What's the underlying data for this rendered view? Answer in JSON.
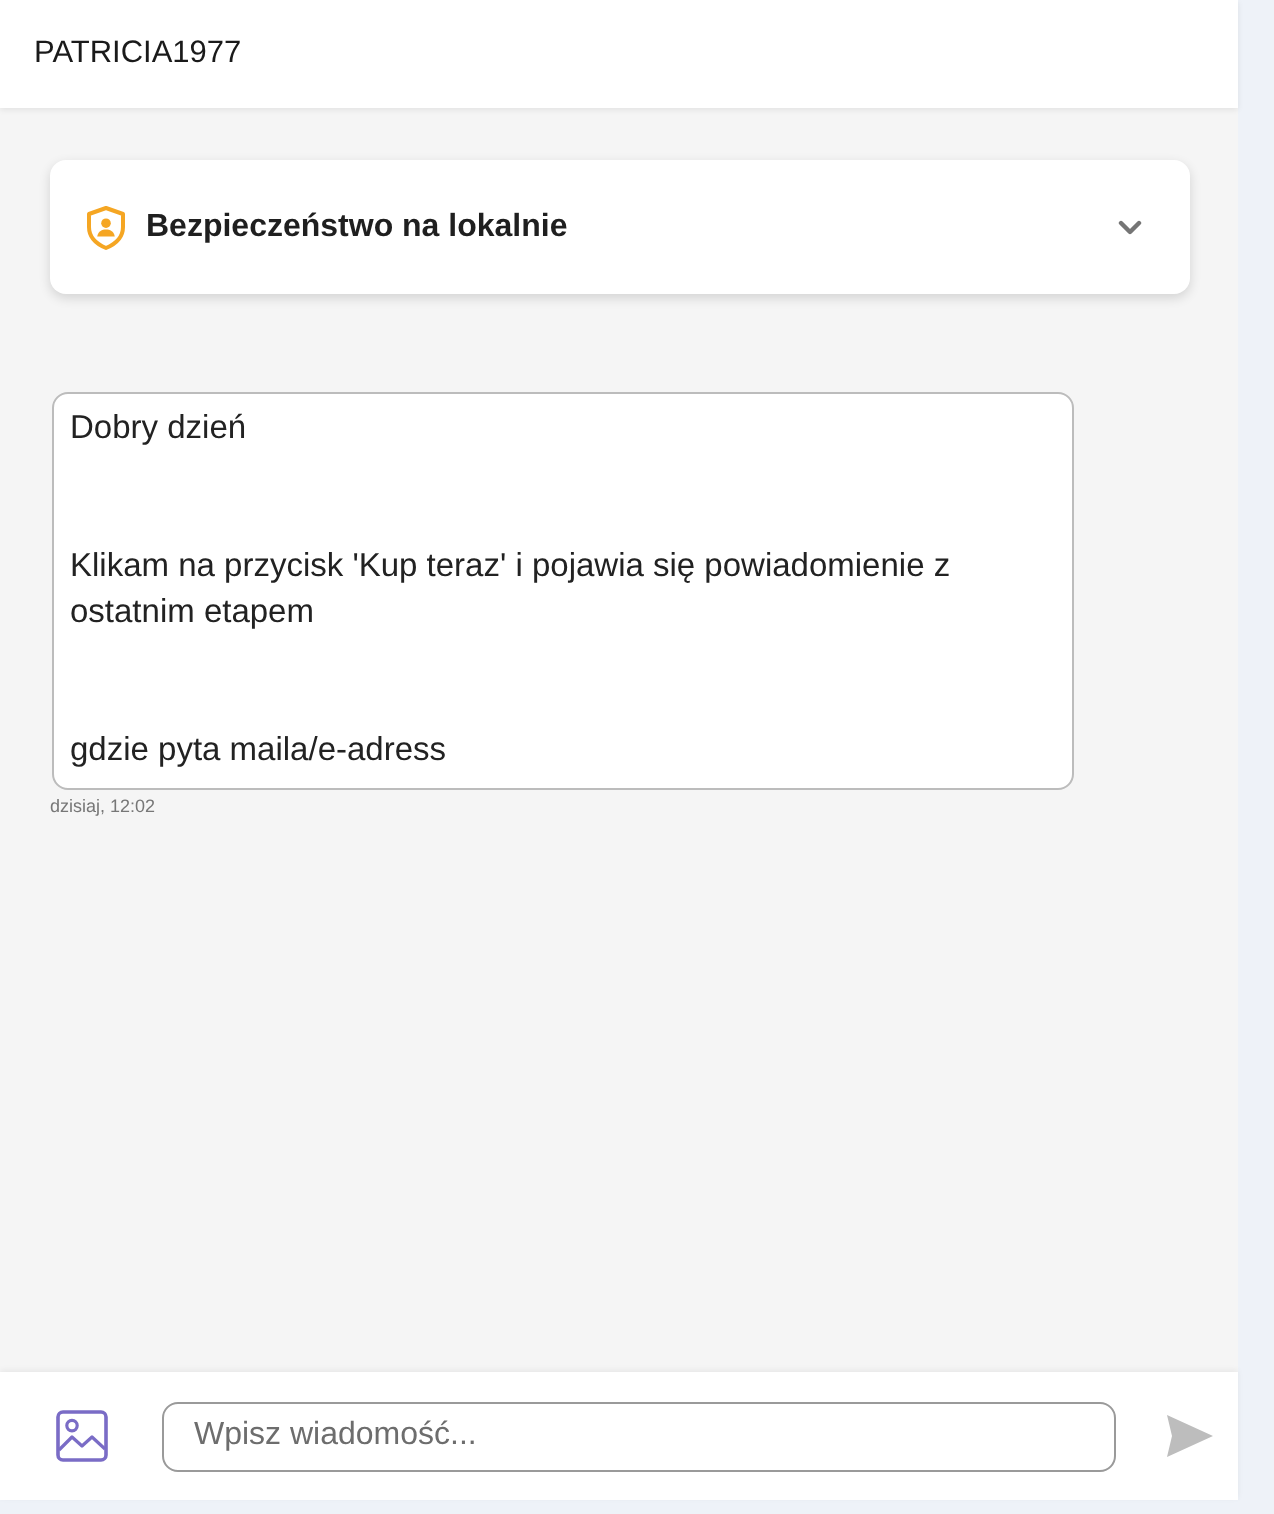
{
  "header": {
    "title": "PATRICIA1977"
  },
  "topic_card": {
    "title": "Bezpieczeństwo na lokalnie",
    "expanded": false
  },
  "messages": [
    {
      "paragraphs": [
        "Dobry dzień",
        "Klikam na przycisk 'Kup teraz' i pojawia się powiadomienie z ostatnim etapem",
        "gdzie pyta maila/e-adress"
      ],
      "time": "dzisiaj, 12:02"
    }
  ],
  "composer": {
    "placeholder": "Wpisz wiadomość..."
  }
}
